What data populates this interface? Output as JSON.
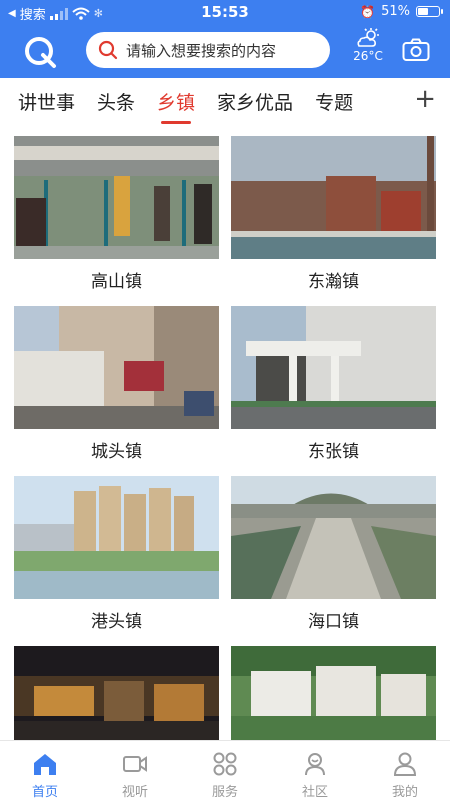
{
  "status_bar": {
    "back_label": "搜索",
    "time": "15:53",
    "battery": "51%",
    "battery_level": 0.51
  },
  "header": {
    "search_placeholder": "请输入想要搜索的内容",
    "temperature": "26°C"
  },
  "tabs": [
    {
      "label": "讲世事",
      "active": false
    },
    {
      "label": "头条",
      "active": false
    },
    {
      "label": "乡镇",
      "active": true
    },
    {
      "label": "家乡优品",
      "active": false
    },
    {
      "label": "专题",
      "active": false
    }
  ],
  "towns": [
    {
      "name": "高山镇"
    },
    {
      "name": "东瀚镇"
    },
    {
      "name": "城头镇"
    },
    {
      "name": "东张镇"
    },
    {
      "name": "港头镇"
    },
    {
      "name": "海口镇"
    },
    {
      "name": ""
    },
    {
      "name": ""
    }
  ],
  "bottom_nav": [
    {
      "label": "首页",
      "icon": "home-icon",
      "active": true
    },
    {
      "label": "视听",
      "icon": "video-icon",
      "active": false
    },
    {
      "label": "服务",
      "icon": "grid-icon",
      "active": false
    },
    {
      "label": "社区",
      "icon": "community-icon",
      "active": false
    },
    {
      "label": "我的",
      "icon": "user-icon",
      "active": false
    }
  ],
  "colors": {
    "brand_blue": "#3d7ff0",
    "active_tab_red": "#e03a2f"
  }
}
